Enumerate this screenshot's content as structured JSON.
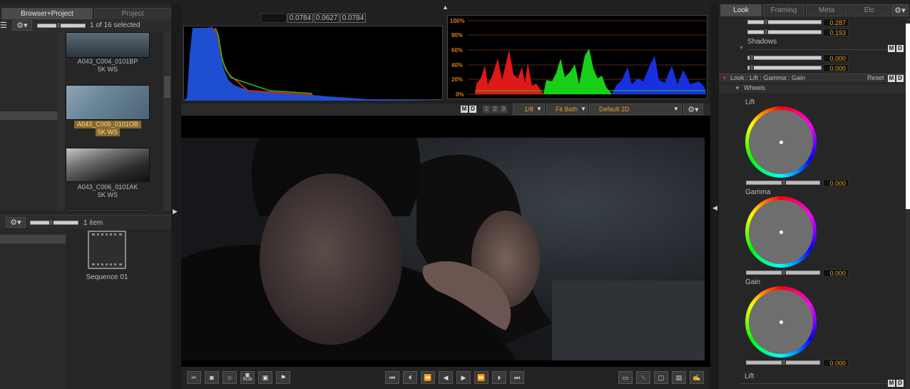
{
  "browser": {
    "tabs": [
      "Browser+Project",
      "Project"
    ],
    "selection_count": "1 of 16 selected",
    "clips": [
      {
        "name": "A043_C004_0101BP",
        "format": "5K WS",
        "selected": false
      },
      {
        "name": "A043_C005_0101OB",
        "format": "5K WS",
        "selected": true
      },
      {
        "name": "A043_C006_0101AK",
        "format": "5K WS",
        "selected": false
      }
    ],
    "project_count": "1 item",
    "sequence_name": "Sequence 01"
  },
  "viewer": {
    "pixel_values": [
      "0.0784",
      "0.0627",
      "0.0784"
    ],
    "waveform_ticks": [
      "100%",
      "80%",
      "60%",
      "40%",
      "20%",
      "0%"
    ],
    "layout_buttons": [
      "1",
      "2",
      "3"
    ],
    "resolution": "1/8",
    "fit_mode": "Fit Both",
    "look_preset": "Default 2D",
    "md_m": "M",
    "md_d": "D"
  },
  "transport": {
    "left_tools": [
      "clip-icon",
      "camera-icon",
      "camera-disabled-icon",
      "rgb-camera-icon",
      "export-icon",
      "flag-icon"
    ],
    "rgb_label": "RGB",
    "playback": [
      "skip-start-icon",
      "prev-mark-icon",
      "rewind-icon",
      "step-back-icon",
      "play-icon",
      "fast-forward-icon",
      "next-mark-icon",
      "skip-end-icon"
    ],
    "right_tools": [
      "monitor-icon",
      "pen-icon",
      "frame-icon",
      "film-icon",
      "edit-icon"
    ]
  },
  "look": {
    "tabs": [
      "Look",
      "Framing",
      "Meta",
      "Etc"
    ],
    "top_values": [
      "0.287",
      "0.193"
    ],
    "shadows_label": "Shadows",
    "shadows_values": [
      "0.000",
      "0.000"
    ],
    "section_title": "Look : Lift : Gamma : Gain",
    "reset_label": "Reset",
    "wheels_label": "Wheels",
    "wheels": [
      {
        "label": "Lift",
        "value": "0.000"
      },
      {
        "label": "Gamma",
        "value": "0.000"
      },
      {
        "label": "Gain",
        "value": "0.000"
      }
    ],
    "bottom_label": "Lift"
  },
  "colors": {
    "accent": "#e8a020",
    "selected_clip": "#8a6a2a",
    "histogram_blue": "#1e4fd0"
  }
}
